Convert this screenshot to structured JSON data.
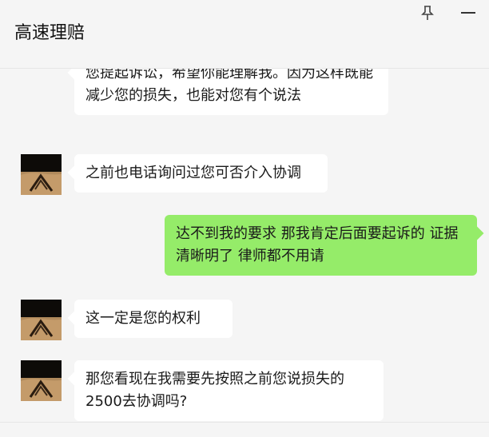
{
  "window": {
    "title": "高速理赔"
  },
  "messages": [
    {
      "side": "in",
      "text": "您提起诉讼，希望你能理解我。因为这样既能减少您的损失，也能对您有个说法",
      "has_avatar": false
    },
    {
      "side": "in",
      "text": "之前也电话询问过您可否介入协调",
      "has_avatar": true
    },
    {
      "side": "out",
      "text": "达不到我的要求 那我肯定后面要起诉的 证据清晰明了  律师都不用请"
    },
    {
      "side": "in",
      "text": "这一定是您的权利",
      "has_avatar": true
    },
    {
      "side": "in",
      "text": "那您看现在我需要先按照之前您说损失的2500去协调吗?",
      "has_avatar": true
    }
  ],
  "icons": {
    "pin": "pin-icon",
    "minimize": "minimize-icon"
  },
  "colors": {
    "incoming_bubble": "#ffffff",
    "outgoing_bubble": "#95ec69",
    "background": "#f5f5f5"
  }
}
